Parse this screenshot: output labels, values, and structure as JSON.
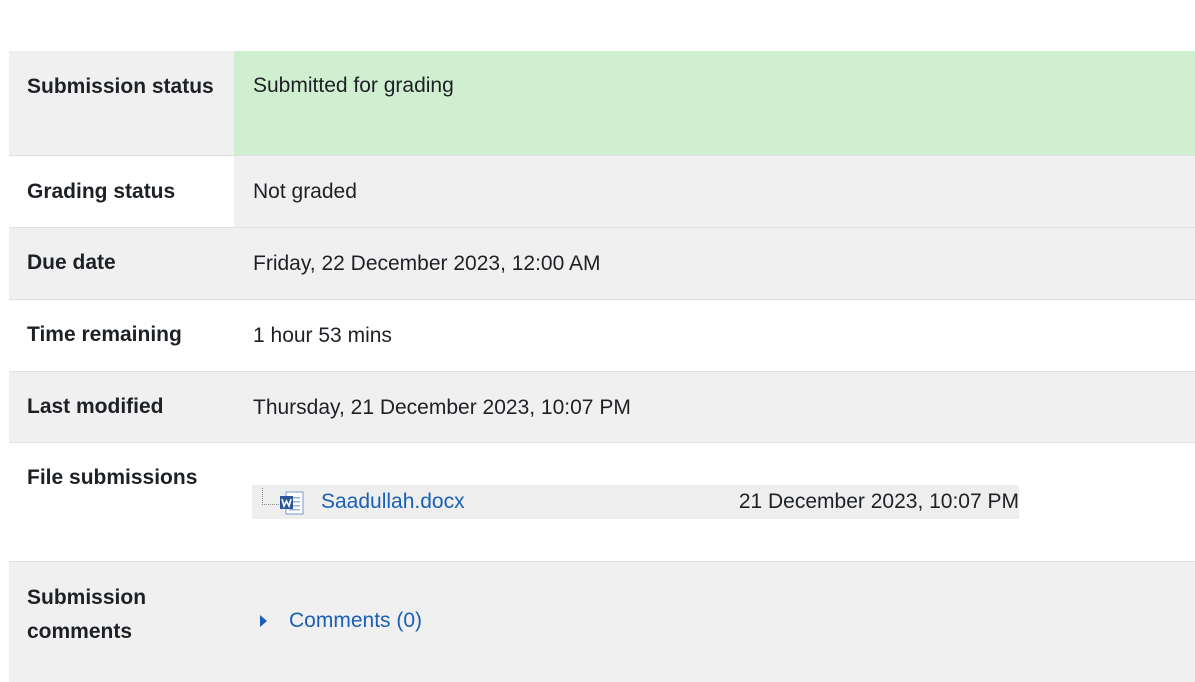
{
  "rows": {
    "submission_status": {
      "label": "Submission status",
      "value": "Submitted for grading"
    },
    "grading_status": {
      "label": "Grading status",
      "value": "Not graded"
    },
    "due_date": {
      "label": "Due date",
      "value": "Friday, 22 December 2023, 12:00 AM"
    },
    "time_remaining": {
      "label": "Time remaining",
      "value": "1 hour 53 mins"
    },
    "last_modified": {
      "label": "Last modified",
      "value": "Thursday, 21 December 2023, 10:07 PM"
    },
    "file_submissions": {
      "label": "File submissions",
      "file": {
        "name": "Saadullah.docx",
        "date": "21 December 2023, 10:07 PM",
        "icon": "word-document-icon"
      }
    },
    "submission_comments": {
      "label": "Submission comments",
      "toggle": "Comments (0)"
    }
  },
  "colors": {
    "submitted_bg": "#d0eed0",
    "stripe_bg": "#f0f0f0",
    "link": "#1a5fb4"
  }
}
